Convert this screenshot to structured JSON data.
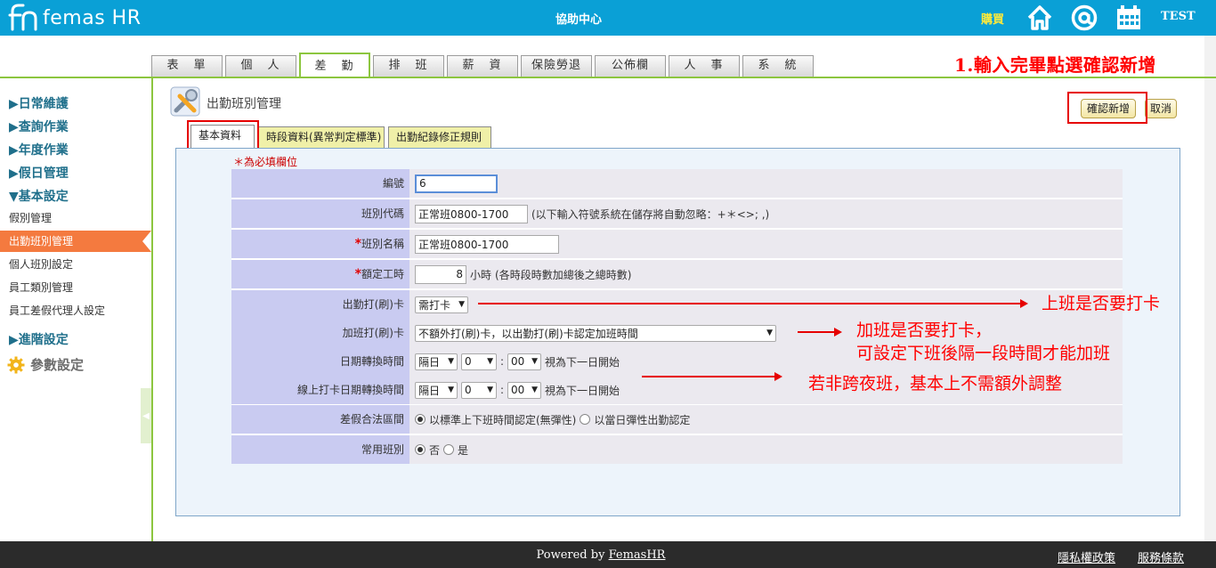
{
  "header": {
    "brand": "femas HR",
    "help_center": "協助中心",
    "buy": "購買",
    "user": "TEST",
    "icons": [
      "home-icon",
      "at-mail-icon",
      "calendar-icon"
    ],
    "color": "#0aa0d6"
  },
  "main_tabs": [
    {
      "label": "表　單",
      "active": false
    },
    {
      "label": "個　人",
      "active": false
    },
    {
      "label": "差　勤",
      "active": true
    },
    {
      "label": "排　班",
      "active": false
    },
    {
      "label": "薪　資",
      "active": false
    },
    {
      "label": "保險勞退",
      "active": false
    },
    {
      "label": "公佈欄",
      "active": false
    },
    {
      "label": "人　事",
      "active": false
    },
    {
      "label": "系　統",
      "active": false
    }
  ],
  "annotation_top": "1.輸入完畢點選確認新增",
  "sidebar": {
    "groups": [
      "▶日常維護",
      "▶查詢作業",
      "▶年度作業",
      "▶假日管理",
      "▼基本設定"
    ],
    "items": [
      "假別管理",
      "出勤班別管理",
      "個人班別設定",
      "員工類別管理",
      "員工差假代理人設定"
    ],
    "active_item": "出勤班別管理",
    "advanced": "▶進階設定",
    "params": "參數設定"
  },
  "page": {
    "title": "出勤班別管理",
    "confirm_button": "確認新增",
    "cancel_button": "取消"
  },
  "sub_tabs": [
    {
      "label": "基本資料",
      "active": true
    },
    {
      "label": "時段資料(異常判定標準)",
      "active": false
    },
    {
      "label": "出勤紀錄修正規則",
      "active": false
    }
  ],
  "form": {
    "required_note": "＊為必填欄位",
    "code": {
      "label": "編號",
      "value": "6"
    },
    "shift_code": {
      "label": "班別代碼",
      "value": "正常班0800-1700",
      "hint": "(以下輸入符號系統在儲存將自動忽略：+＊<>; ,)"
    },
    "shift_name": {
      "label": "班別名稱",
      "value": "正常班0800-1700"
    },
    "work_hours": {
      "label": "額定工時",
      "value": "8",
      "unit": "小時",
      "hint": "(各時段時數加總後之總時數)"
    },
    "clock_in": {
      "label": "出勤打(刷)卡",
      "value": "需打卡"
    },
    "overtime_clock": {
      "label": "加班打(刷)卡",
      "value": "不額外打(刷)卡，以出勤打(刷)卡認定加班時間"
    },
    "date_switch": {
      "label": "日期轉換時間",
      "day": "隔日",
      "hour": "0",
      "minute": "00",
      "suffix": "視為下一日開始"
    },
    "online_date_switch": {
      "label": "線上打卡日期轉換時間",
      "day": "隔日",
      "hour": "0",
      "minute": "00",
      "suffix": "視為下一日開始"
    },
    "leave_range": {
      "label": "差假合法區間",
      "option1": "以標準上下班時間認定(無彈性)",
      "option2": "以當日彈性出勤認定",
      "selected": 1
    },
    "common_shift": {
      "label": "常用班別",
      "option_no": "否",
      "option_yes": "是",
      "selected": "否"
    },
    "colon": ":"
  },
  "annotations": {
    "clock_in": "上班是否要打卡",
    "overtime_line1": "加班是否要打卡，",
    "overtime_line2": "可設定下班後隔一段時間才能加班",
    "overnight": "若非跨夜班，基本上不需額外調整"
  },
  "footer": {
    "powered_prefix": "Powered by",
    "powered_brand": "FemasHR",
    "privacy": "隱私權政策",
    "terms": "服務條款",
    "color": "#2b2b2b"
  }
}
